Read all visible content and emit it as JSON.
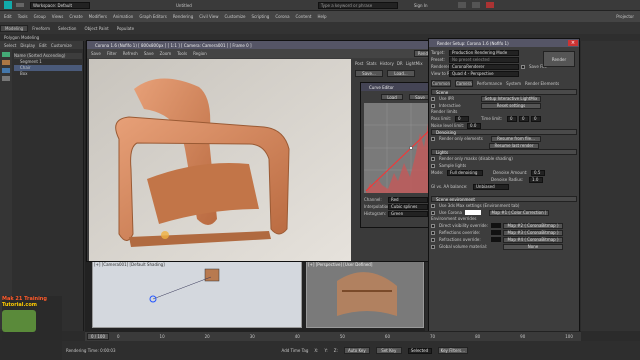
{
  "titlebar": {
    "workspace": "Workspace: Default",
    "file": "Untitled",
    "search_placeholder": "Type a keyword or phrase",
    "signin": "Sign In"
  },
  "menu": {
    "items": [
      "Edit",
      "Tools",
      "Group",
      "Views",
      "Create",
      "Modifiers",
      "Animation",
      "Graph Editors",
      "Rendering",
      "Civil View",
      "Customize",
      "Scripting",
      "Corona",
      "Content",
      "Help"
    ],
    "right": "Projector"
  },
  "ribbon": {
    "tabs": [
      "Modeling",
      "Freeform",
      "Selection",
      "Object Paint",
      "Populate"
    ],
    "sub": "Polygon Modeling"
  },
  "scene": {
    "tabs": [
      "Select",
      "Display",
      "Edit",
      "Customize"
    ],
    "header": "Name (Sorted Ascending)",
    "items": [
      "Segment 1",
      "Chair",
      "Box"
    ]
  },
  "vfb": {
    "title": "Corona 1.6 (Nofifo 1) [ 800x800px ] [ 1:1 ] [ Camera: Camera001 ] [ Frame 0 ]",
    "toolbar": [
      "Save",
      "Filter",
      "Refresh",
      "Save",
      "Zoom",
      "Tools",
      "Region"
    ],
    "render_button": "Render",
    "side_tabs": [
      "Post",
      "Stats",
      "History",
      "DR",
      "LightMix"
    ],
    "side_buttons": [
      "Save...",
      "Load..."
    ]
  },
  "curve": {
    "title": "Curve Editor",
    "load": "Load",
    "save": "Save",
    "channel_label": "Channel:",
    "channel_value": "Red",
    "reset": "Reset",
    "interp_label": "Interpolation:",
    "interp_value": "Cubic splines",
    "fit": "Fit",
    "hist_label": "Histogram:",
    "hist_value": "Green",
    "equalize": "Equalize"
  },
  "render_setup": {
    "title": "Render Setup: Corona 1.6 (Nofifo 1)",
    "target_label": "Target:",
    "target": "Production Rendering Mode",
    "preset_label": "Preset:",
    "preset": "No preset selected",
    "renderer_label": "Renderer:",
    "renderer": "CoronaRenderer",
    "save_file": "Save File",
    "view_label": "View to Render:",
    "view": "Quad 4 - Perspective",
    "render": "Render",
    "tabs": [
      "Common",
      "Camera",
      "Performance",
      "System",
      "Render Elements"
    ],
    "sec_scene": "Scene",
    "use_ipr": "Use IPR",
    "interactive": "Interactive",
    "ipr_btn": "Setup Interactive LightMix",
    "reset_settings": "Reset settings",
    "limits": "Render limits",
    "pass_limit": "Pass limit:",
    "pass_val": "0",
    "time_limit": "Time limit:",
    "time_vals": [
      "0",
      "0",
      "0"
    ],
    "noise": "Noise level limit:",
    "noise_val": "0.0",
    "sec_denoise": "Denoising",
    "render_only": "Render only elements",
    "resume": "Resume from file...",
    "resume2": "Resume last render",
    "sec_lights": "Lights",
    "render_sel": "Render only masks (disable shading)",
    "sample_light": "Sample lights",
    "mode_label": "Mode:",
    "mode": "Full denoising",
    "amount_label": "Denoise Amount:",
    "amount": "0.5",
    "radius_label": "Denoise Radius:",
    "radius": "1.0",
    "gi": "GI vs. AA balance:",
    "unbiased": "Unbiased",
    "sec_env": "Scene environment",
    "use3dsmax": "Use 3ds Max settings (Environment tab)",
    "use_corona": "Use Corona",
    "map1": "Map #1 ( Color Correction )",
    "env_overrides": "Environment overrides",
    "direct": "Direct visibility override:",
    "map2": "Map #2 ( CoronaBitmap )",
    "refl": "Reflections override:",
    "map3": "Map #3 ( CoronaBitmap )",
    "refr": "Refractions override:",
    "map4": "Map #4 ( CoronaBitmap )",
    "vol": "Global volume material:",
    "none": "None"
  },
  "viewports": {
    "left_label": "[+] [Camera001] [Default Shading]",
    "right_label": "[+] [Perspective] [User Defined]"
  },
  "timeline": {
    "frame": "0 / 100",
    "ticks": [
      "0",
      "10",
      "20",
      "30",
      "40",
      "50",
      "60",
      "70",
      "80",
      "90",
      "100"
    ]
  },
  "status": {
    "text": "Rendering Time: 0:00:03",
    "add_tag": "Add Time Tag",
    "selected": "Selected",
    "key_filters": "Key Filters...",
    "autokey": "Auto Key",
    "setkey": "Set Key",
    "coords": [
      "X:",
      "Y:",
      "Z:"
    ]
  },
  "watermark": {
    "line1": "Mak 21 Training",
    "line2": "Tutorial.com"
  },
  "colors": {
    "accent": "#556677",
    "render_bg": "#d8d4ce",
    "chair": "#d68a5c"
  }
}
